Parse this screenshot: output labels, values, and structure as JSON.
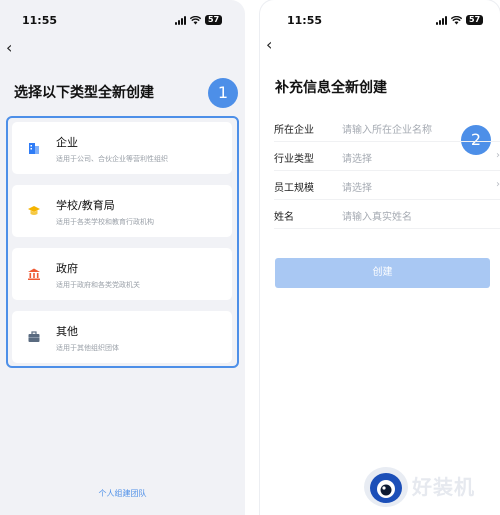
{
  "left": {
    "status_time": "11:55",
    "battery": "57",
    "back_glyph": "‹",
    "title": "选择以下类型全新创建",
    "step_badge": "1",
    "types": [
      {
        "name": "企业",
        "desc": "适用于公司、合伙企业等营利性组织",
        "icon": "building-icon",
        "icon_color": "#2f7cf6"
      },
      {
        "name": "学校/教育局",
        "desc": "适用于各类学校和教育行政机构",
        "icon": "graduation-cap-icon",
        "icon_color": "#f5b400"
      },
      {
        "name": "政府",
        "desc": "适用于政府和各类党政机关",
        "icon": "government-icon",
        "icon_color": "#ef5a34"
      },
      {
        "name": "其他",
        "desc": "适用于其他组织团体",
        "icon": "briefcase-icon",
        "icon_color": "#5a6b80"
      }
    ],
    "bottom_link": "个人组建团队"
  },
  "right": {
    "status_time": "11:55",
    "battery": "57",
    "back_glyph": "‹",
    "title": "补充信息全新创建",
    "step_badge": "2",
    "fields": [
      {
        "label": "所在企业",
        "placeholder": "请输入所在企业名称",
        "chevron": ""
      },
      {
        "label": "行业类型",
        "placeholder": "请选择",
        "chevron": "›"
      },
      {
        "label": "员工规模",
        "placeholder": "请选择",
        "chevron": "›"
      },
      {
        "label": "姓名",
        "placeholder": "请输入真实姓名",
        "chevron": ""
      }
    ],
    "create_button": "创建"
  },
  "watermark": {
    "text": "好装机"
  },
  "colors": {
    "accent": "#4d8fe8",
    "button_disabled": "#a9c8f3",
    "background": "#f1f2f6"
  }
}
